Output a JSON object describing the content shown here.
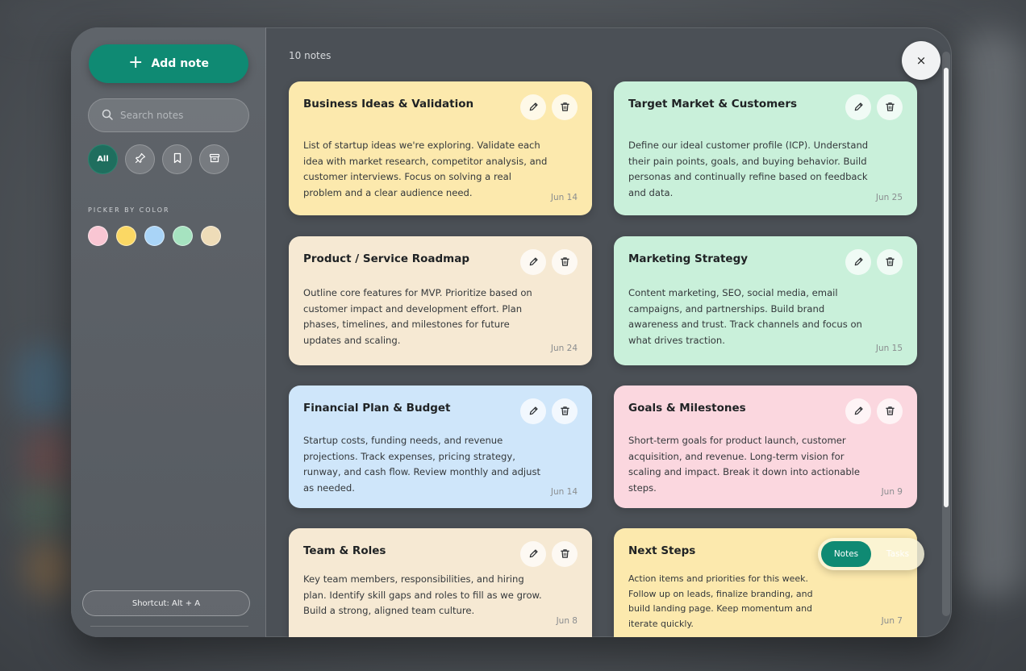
{
  "sidebar": {
    "add_note_label": "Add note",
    "search_placeholder": "Search notes",
    "filters": [
      {
        "label": "All",
        "icon": "all",
        "active": true
      },
      {
        "label": "",
        "icon": "pin-icon"
      },
      {
        "label": "",
        "icon": "bookmark-icon"
      },
      {
        "label": "",
        "icon": "archive-icon"
      }
    ],
    "picker_label": "PICKER BY COLOR",
    "swatches": [
      "#f9c6d3",
      "#fbd864",
      "#a9d4f7",
      "#a6e3c0",
      "#eedcb8"
    ],
    "shortcut_label": "Shortcut: Alt + A"
  },
  "main": {
    "count_label": "10 notes",
    "close_label": "×",
    "notes": [
      {
        "title": "Business Ideas & Validation",
        "body": "List of startup ideas we're exploring. Validate each idea with market research, competitor analysis, and customer interviews. Focus on solving a real problem and a clear audience need.",
        "date": "Jun 14",
        "color": "yellow"
      },
      {
        "title": "Target Market & Customers",
        "body": "Define our ideal customer profile (ICP). Understand their pain points, goals, and buying behavior. Build personas and continually refine based on feedback and data.",
        "date": "Jun 25",
        "color": "mint"
      },
      {
        "title": "Product / Service Roadmap",
        "body": "Outline core features for MVP. Prioritize based on customer impact and development effort. Plan phases, timelines, and milestones for future updates and scaling.",
        "date": "Jun 24",
        "color": "cream"
      },
      {
        "title": "Marketing Strategy",
        "body": "Content marketing, SEO, social media, email campaigns, and partnerships. Build brand awareness and trust. Track channels and focus on what drives traction.",
        "date": "Jun 15",
        "color": "mint"
      },
      {
        "title": "Financial Plan & Budget",
        "body": "Startup costs, funding needs, and revenue projections. Track expenses, pricing strategy, runway, and cash flow. Review monthly and adjust as needed.",
        "date": "Jun 14",
        "color": "blue"
      },
      {
        "title": "Goals & Milestones",
        "body": "Short-term goals for product launch, customer acquisition, and revenue. Long-term vision for scaling and impact. Break it down into actionable steps.",
        "date": "Jun 9",
        "color": "pink"
      },
      {
        "title": "Team & Roles",
        "body": "Key team members, responsibilities, and hiring plan. Identify skill gaps and roles to fill as we grow. Build a strong, aligned team culture.",
        "date": "Jun 8",
        "color": "cream"
      },
      {
        "title": "Next Steps",
        "body": "Action items and priorities for this week. Follow up on leads, finalize branding, and build landing page. Keep momentum and iterate quickly.",
        "date": "Jun 7",
        "color": "yellow"
      }
    ],
    "toggle": {
      "active": "Notes",
      "inactive": "Tasks"
    }
  }
}
